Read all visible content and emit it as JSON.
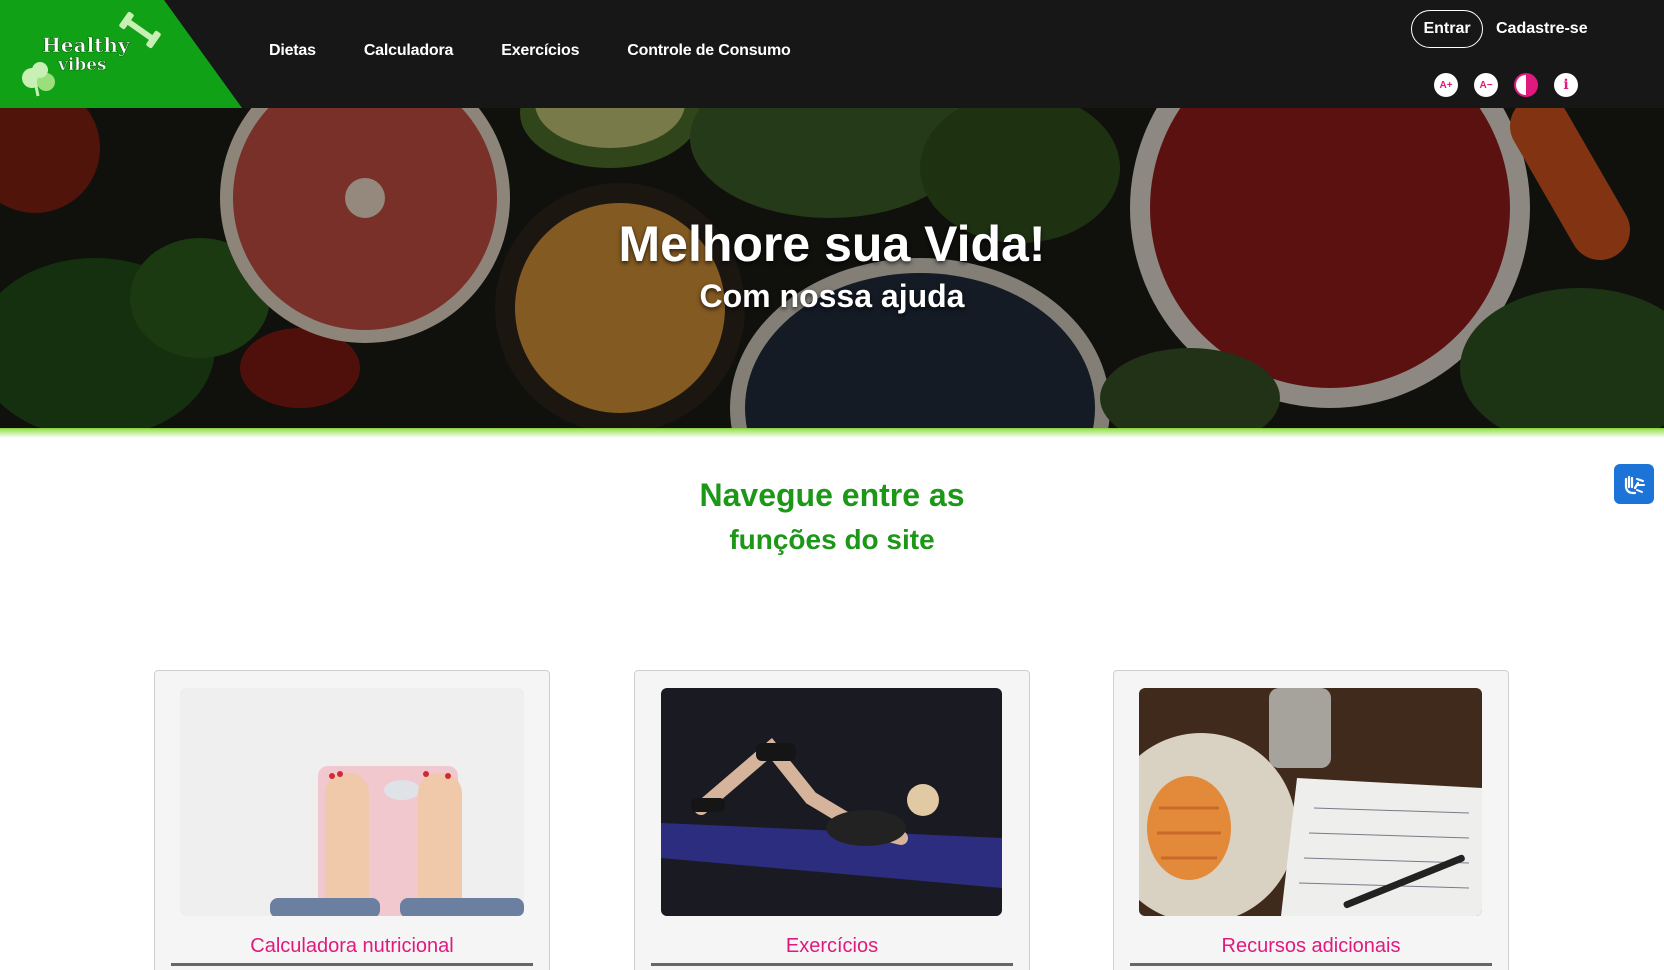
{
  "brand": {
    "logo_line1": "Healthy",
    "logo_line2": "vibes",
    "logo_bg": "#11a117"
  },
  "nav": {
    "items": [
      {
        "label": "Dietas"
      },
      {
        "label": "Calculadora"
      },
      {
        "label": "Exercícios"
      },
      {
        "label": "Controle de Consumo"
      }
    ]
  },
  "auth": {
    "login_label": "Entrar",
    "signup_label": "Cadastre-se"
  },
  "accessibility": {
    "increase_font": "A+",
    "decrease_font": "A−",
    "info": "i",
    "icons": [
      "font-increase-icon",
      "font-decrease-icon",
      "contrast-icon",
      "info-icon"
    ],
    "accent": "#e0197e"
  },
  "hero": {
    "title": "Melhore sua Vida!",
    "subtitle": "Com nossa ajuda"
  },
  "section": {
    "title": "Navegue entre as",
    "subtitle": "funções do site",
    "color": "#1c9718"
  },
  "cards": [
    {
      "label": "Calculadora nutricional",
      "image": "scale-photo"
    },
    {
      "label": "Exercícios",
      "image": "workout-photo"
    },
    {
      "label": "Recursos adicionais",
      "image": "food-log-photo"
    }
  ],
  "widgets": {
    "vlibras_icon": "sign-language-hands-icon"
  }
}
